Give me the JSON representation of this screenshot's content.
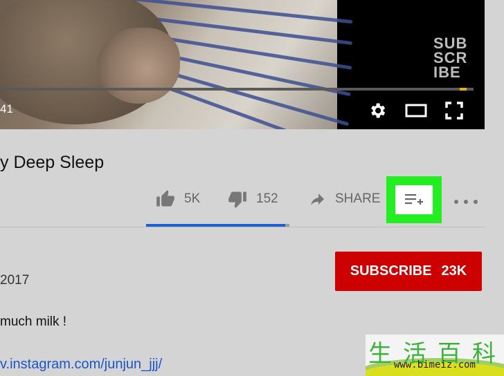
{
  "video": {
    "time_display": "41",
    "watermark_lines": [
      "SUB",
      "SCR",
      "IBE"
    ],
    "progress_fraction": 0.985
  },
  "video_title": "y Deep Sleep",
  "actions": {
    "like_count": "5K",
    "dislike_count": "152",
    "share_label": "SHARE",
    "like_ratio": 0.97
  },
  "channel": {
    "subscribe_label": "SUBSCRIBE",
    "subscriber_count": "23K",
    "published_date": "2017"
  },
  "description": {
    "line1": "much milk !",
    "link": "v.instagram.com/junjun_jjj/"
  },
  "watermark": {
    "chars": "生活百科",
    "url": "www.bimeiz.com"
  },
  "colors": {
    "subscribe_red": "#cc0000",
    "highlight_green": "#22ee22",
    "like_bar_blue": "#1e5fd2",
    "link_blue": "#1b56c9"
  }
}
